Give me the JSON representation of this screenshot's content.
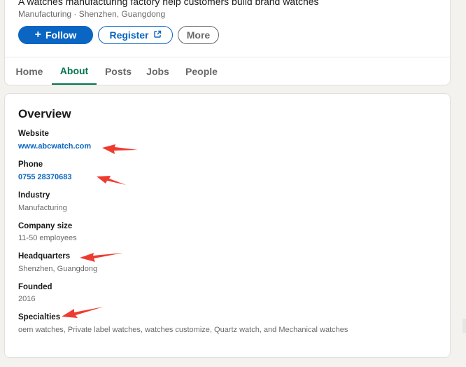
{
  "company": {
    "tagline": "A watches manufacturing factory help customers build brand watches",
    "meta": "Manufacturing · Shenzhen, Guangdong"
  },
  "actions": {
    "follow_label": "Follow",
    "follow_icon": "plus-icon",
    "register_label": "Register",
    "register_icon": "external-link-icon",
    "more_label": "More"
  },
  "tabs": [
    {
      "label": "Home",
      "active": false
    },
    {
      "label": "About",
      "active": true
    },
    {
      "label": "Posts",
      "active": false
    },
    {
      "label": "Jobs",
      "active": false
    },
    {
      "label": "People",
      "active": false
    }
  ],
  "overview": {
    "title": "Overview",
    "website": {
      "label": "Website",
      "value": "www.abcwatch.com"
    },
    "phone": {
      "label": "Phone",
      "value": "0755 28370683"
    },
    "industry": {
      "label": "Industry",
      "value": "Manufacturing"
    },
    "company_size": {
      "label": "Company size",
      "value": "11-50 employees"
    },
    "headquarters": {
      "label": "Headquarters",
      "value": "Shenzhen, Guangdong"
    },
    "founded": {
      "label": "Founded",
      "value": "2016"
    },
    "specialties": {
      "label": "Specialties",
      "value": "oem watches, Private label watches, watches customize, Quartz watch, and Mechanical watches"
    }
  },
  "colors": {
    "brand_blue": "#0a66c2",
    "active_tab_green": "#01754f",
    "annotation_red": "#ee3b30",
    "page_bg": "#f4f2ee"
  }
}
